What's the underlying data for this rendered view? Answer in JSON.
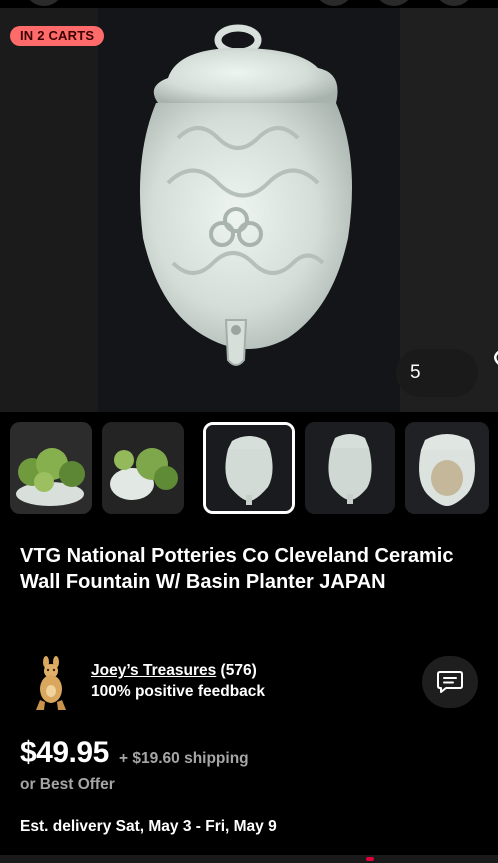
{
  "badge": {
    "carts": "IN 2 CARTS"
  },
  "watch": {
    "count": "5",
    "icon": "heart-icon"
  },
  "thumbnails": [
    {
      "name": "thumbnail-1",
      "selected": false
    },
    {
      "name": "thumbnail-2",
      "selected": false
    },
    {
      "name": "thumbnail-3",
      "selected": true
    },
    {
      "name": "thumbnail-4",
      "selected": false
    },
    {
      "name": "thumbnail-5",
      "selected": false
    }
  ],
  "listing": {
    "title": "VTG National Potteries Co Cleveland Ceramic Wall Fountain W/ Basin Planter JAPAN",
    "price": "$49.95",
    "shipping": "+ $19.60 shipping",
    "offer": "or Best Offer",
    "delivery": "Est. delivery Sat, May 3 - Fri, May 9"
  },
  "seller": {
    "name": "Joey’s Treasures",
    "rating_count": "(576)",
    "feedback": "100% positive feedback",
    "message_icon": "message-icon"
  },
  "colors": {
    "badge_bg": "#ff6a6a",
    "background": "#000000",
    "secondary_text": "#a6a6a6"
  }
}
